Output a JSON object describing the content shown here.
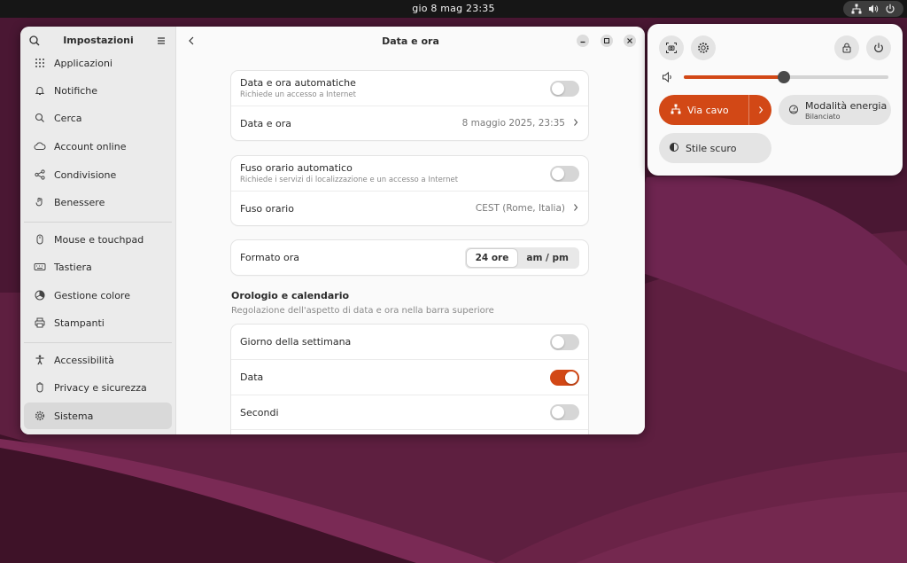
{
  "topbar": {
    "clock": "gio 8 mag  23:35"
  },
  "sidebar": {
    "title": "Impostazioni",
    "items": [
      {
        "label": "Applicazioni",
        "icon": "grid-icon"
      },
      {
        "label": "Notifiche",
        "icon": "bell-icon"
      },
      {
        "label": "Cerca",
        "icon": "search-icon"
      },
      {
        "label": "Account online",
        "icon": "cloud-icon"
      },
      {
        "label": "Condivisione",
        "icon": "share-icon"
      },
      {
        "label": "Benessere",
        "icon": "wellbeing-icon"
      },
      {
        "label": "Mouse e touchpad",
        "icon": "mouse-icon"
      },
      {
        "label": "Tastiera",
        "icon": "keyboard-icon"
      },
      {
        "label": "Gestione colore",
        "icon": "color-icon"
      },
      {
        "label": "Stampanti",
        "icon": "printer-icon"
      },
      {
        "label": "Accessibilità",
        "icon": "accessibility-icon"
      },
      {
        "label": "Privacy e sicurezza",
        "icon": "hand-icon"
      },
      {
        "label": "Sistema",
        "icon": "gear-icon",
        "active": true
      }
    ]
  },
  "content": {
    "title": "Data e ora",
    "auto_datetime": {
      "label": "Data e ora automatiche",
      "sub": "Richiede un accesso a Internet",
      "on": false
    },
    "datetime": {
      "label": "Data e ora",
      "value": "8 maggio 2025, 23:35"
    },
    "auto_timezone": {
      "label": "Fuso orario automatico",
      "sub": "Richiede i servizi di localizzazione e un accesso a Internet",
      "on": false
    },
    "timezone": {
      "label": "Fuso orario",
      "value": "CEST (Rome, Italia)"
    },
    "time_format": {
      "label": "Formato ora",
      "option_24": "24 ore",
      "option_ampm": "am / pm",
      "selected": "24 ore"
    },
    "clock_section": {
      "title": "Orologio e calendario",
      "description": "Regolazione dell'aspetto di data e ora nella barra superiore"
    },
    "weekday": {
      "label": "Giorno della settimana",
      "on": false
    },
    "date": {
      "label": "Data",
      "on": true
    },
    "seconds": {
      "label": "Secondi",
      "on": false
    }
  },
  "quick_settings": {
    "volume": 0.49,
    "wired": {
      "label": "Via cavo"
    },
    "power_mode": {
      "label": "Modalità energia",
      "sub": "Bilanciato"
    },
    "dark_style": {
      "label": "Stile scuro"
    }
  },
  "colors": {
    "accent": "#d24816",
    "wallpaper": "#5a1e3c",
    "topbar": "#161616"
  }
}
